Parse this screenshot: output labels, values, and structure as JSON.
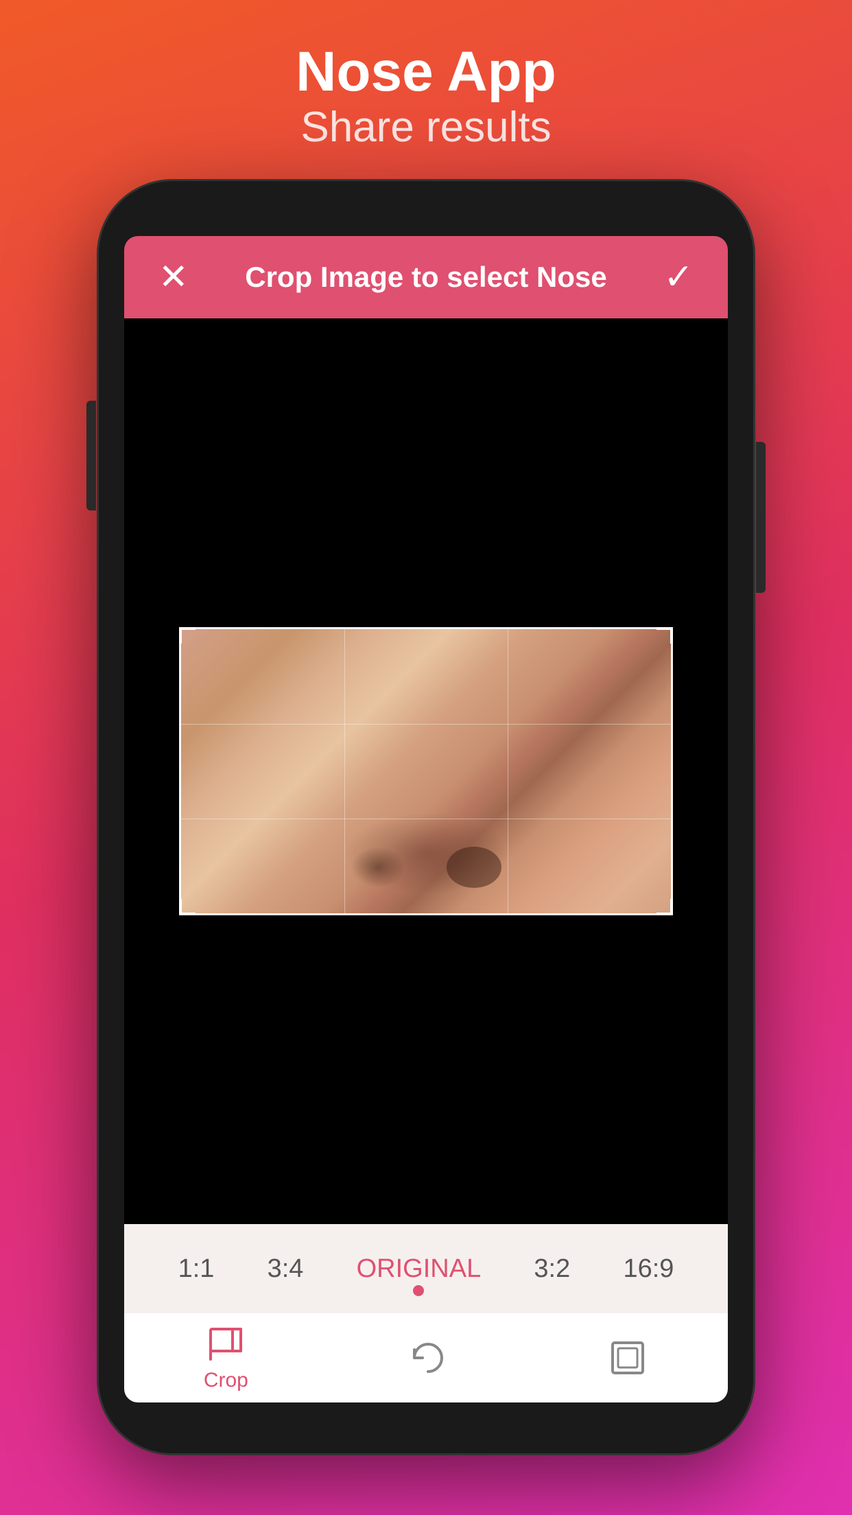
{
  "background": {
    "gradient_start": "#f05a28",
    "gradient_end": "#e030b0"
  },
  "header": {
    "title": "Nose App",
    "subtitle": "Share results"
  },
  "toolbar": {
    "cancel_label": "✕",
    "title": "Crop Image to select Nose",
    "confirm_label": "✓"
  },
  "ratio_bar": {
    "items": [
      {
        "label": "1:1",
        "active": false
      },
      {
        "label": "3:4",
        "active": false
      },
      {
        "label": "ORIGINAL",
        "active": true
      },
      {
        "label": "3:2",
        "active": false
      },
      {
        "label": "16:9",
        "active": false
      }
    ]
  },
  "bottom_toolbar": {
    "items": [
      {
        "label": "Crop",
        "active": true
      },
      {
        "label": "",
        "active": false
      },
      {
        "label": "",
        "active": false
      }
    ],
    "crop_label": "Crop"
  }
}
